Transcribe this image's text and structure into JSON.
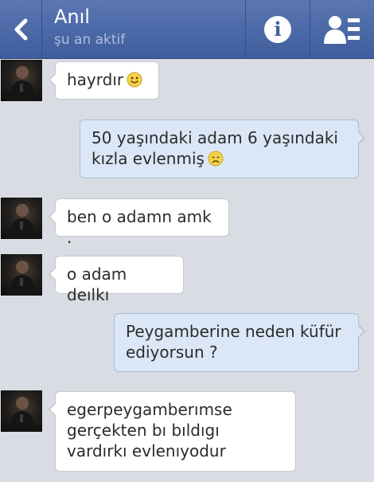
{
  "header": {
    "contact_name": "Anıl",
    "status": "şu an aktif",
    "back_icon": "chevron-left-icon",
    "info_icon": "info-icon",
    "friends_icon": "friend-list-icon"
  },
  "colors": {
    "header": "#3f5d9c",
    "background": "#d9dde3",
    "incoming_bubble": "#ffffff",
    "outgoing_bubble": "#dbe7f7"
  },
  "messages": [
    {
      "direction": "incoming",
      "text": "hayrdır",
      "emoji": "smile-emoji"
    },
    {
      "direction": "outgoing",
      "text": "50 yaşındaki adam 6 yaşındaki kızla evlenmiş",
      "emoji": "sad-emoji"
    },
    {
      "direction": "incoming",
      "text": "ben o adamn amk ."
    },
    {
      "direction": "incoming",
      "text": "o adam deılkı"
    },
    {
      "direction": "outgoing",
      "text": "Peygamberine neden küfür ediyorsun ?"
    },
    {
      "direction": "incoming",
      "text": "egerpeygamberımse gerçekten bı bıldıgı vardırkı evlenıyodur"
    }
  ]
}
